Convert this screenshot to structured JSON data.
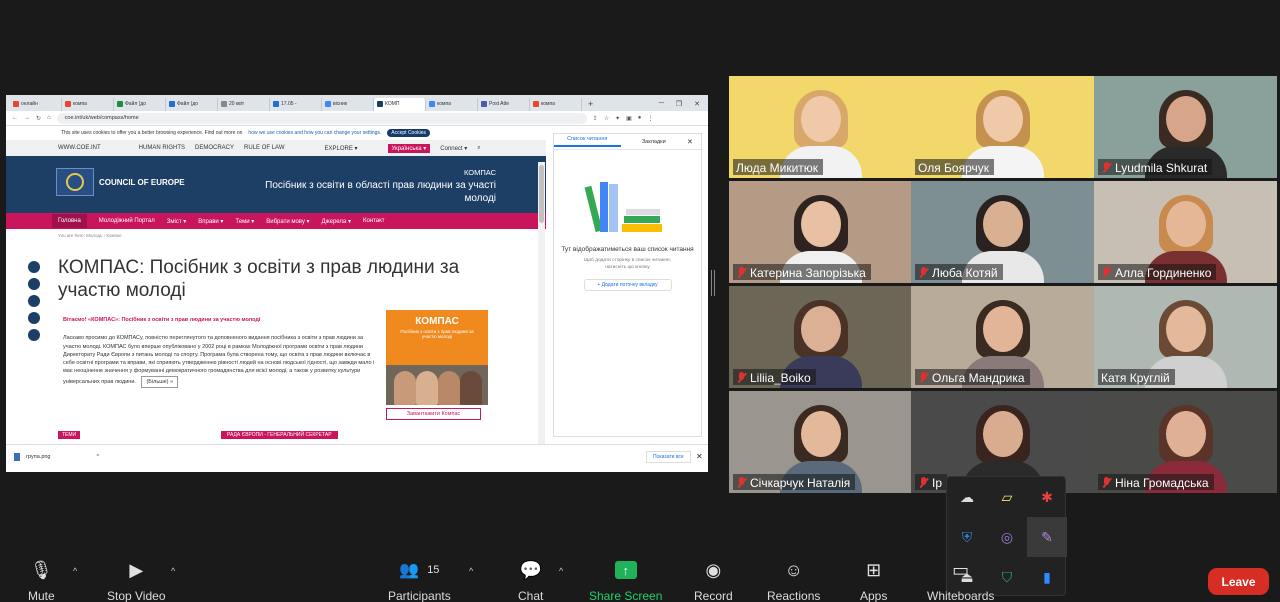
{
  "browser": {
    "tabs": [
      {
        "label": "онлайн",
        "color": "#e8472f"
      },
      {
        "label": "компа",
        "color": "#e8472f"
      },
      {
        "label": "Файл (до",
        "color": "#1e8e3e"
      },
      {
        "label": "Файл (до",
        "color": "#1e6fd9"
      },
      {
        "label": "20 квіт",
        "color": "#888888"
      },
      {
        "label": "17.05 -",
        "color": "#1e6fd9"
      },
      {
        "label": "вісник",
        "color": "#4285f4"
      },
      {
        "label": "КОМП",
        "color": "#1d3f66"
      },
      {
        "label": "компа",
        "color": "#4285f4"
      },
      {
        "label": "Post Atte",
        "color": "#4a5aa8"
      },
      {
        "label": "компа",
        "color": "#e8472f"
      }
    ],
    "url": "coe.int/uk/web/compass/home"
  },
  "site": {
    "cookie_text": "This site uses cookies to offer you a better browsing experience. Find out more on",
    "cookie_link": "how we use cookies and how you can change your settings.",
    "cookie_button": "Accept Cookies",
    "domain": "WWW.COE.INT",
    "topnav": [
      "HUMAN RIGHTS",
      "DEMOCRACY",
      "RULE OF LAW"
    ],
    "explore": "EXPLORE ▾",
    "language": "Українська ▾",
    "connect": "Connect ▾",
    "org_small": "COUNCIL OF EUROPE",
    "org_name": "COUNCIL OF EUROPE",
    "banner_small": "КОМПАС",
    "banner_title": "Посібник з освіти в області прав людини за участі молоді",
    "mainnav": [
      "Головна",
      "Молодіжний Портал",
      "Зміст ▾",
      "Вправи ▾",
      "Теми ▾",
      "Вибрати мову ▾",
      "Джерела ▾",
      "Контакт"
    ],
    "breadcrumb": "You are here:   Молодь   ›   Компас",
    "heading": "КОМПАС: Посібник з освіти з прав людини за участю молоді",
    "lead": "Вітаємо! «КОМПАС»: Посібник з освіти з прав людини за участю молоді",
    "body": "Ласкаво просимо до КОМПАСу, повністю переглянутого та доповненого видання посібника з освіти з прав людини за участю молоді. КОМПАС було вперше опубліковано у 2002 році в рамках Молодіжної програми освіти з прав людини Директорату Ради Європи з питань молоді та спорту. Програма була створена тому, що освіта з прав людини включає в себе освітні програми та вправи, які сприяють утвердженню рівності людей на основі людської гідності, що завжди мало і має неоціненне значення у формуванні демократичного громадянства для всієї молоді, а також у розвитку культури універсальних прав людини.",
    "more": "(Більше) »",
    "book_title": "КОМПАС",
    "book_sub": "Посібник з освіти з прав людини за участю молоді",
    "download": "Завантажити Компас",
    "tag_a": "ТЕМИ",
    "tag_b": "РАДА ЄВРОПИ - ГЕНЕРАЛЬНИЙ СЕКРЕТАР"
  },
  "reading_list": {
    "tab_reading": "Список читання",
    "tab_bookmarks": "Закладки",
    "main": "Тут відображатиметься ваш список читання",
    "sub": "Щоб додати сторінку в список читання, натисніть цю кнопку",
    "button": "+ Додати поточну вкладку"
  },
  "downloads": {
    "file": "група.png",
    "show_all": "Показати все"
  },
  "participants": [
    {
      "name": "Люда Микитюк",
      "muted": false,
      "speaker": true,
      "bg": "#f2d76b",
      "skin": "#f0c9a8",
      "hair": "#d8a86a",
      "shirt": "#f2f2f2"
    },
    {
      "name": "Оля Боярчук",
      "muted": false,
      "speaker": false,
      "bg": "#f2d76b",
      "skin": "#f0c9a8",
      "hair": "#c4924e",
      "shirt": "#f4f4f4"
    },
    {
      "name": "Lyudmila Shkurat",
      "muted": true,
      "speaker": false,
      "bg": "#8aa09a",
      "skin": "#d6a58a",
      "hair": "#3a2a22",
      "shirt": "#2a2a2a"
    },
    {
      "name": "Катерина Запорізька",
      "muted": true,
      "speaker": false,
      "bg": "#b59a86",
      "skin": "#e8c0a4",
      "hair": "#2e2320",
      "shirt": "#f0f0f0"
    },
    {
      "name": "Люба Котяй",
      "muted": true,
      "speaker": false,
      "bg": "#7d8f93",
      "skin": "#d9b092",
      "hair": "#2a2220",
      "shirt": "#e8e8e8"
    },
    {
      "name": "Алла Гординенко",
      "muted": true,
      "speaker": false,
      "bg": "#c8bfb4",
      "skin": "#e6b796",
      "hair": "#c88a4e",
      "shirt": "#7a3030"
    },
    {
      "name": "Liliia_Boiko",
      "muted": true,
      "speaker": false,
      "bg": "#6b6655",
      "skin": "#dcb094",
      "hair": "#4a3226",
      "shirt": "#3a3a5a"
    },
    {
      "name": "Ольга Мандрика",
      "muted": true,
      "speaker": false,
      "bg": "#b8ab9a",
      "skin": "#e2b498",
      "hair": "#3a2a22",
      "shirt": "#8a7a7a"
    },
    {
      "name": "Катя Круглій",
      "muted": false,
      "speaker": false,
      "bg": "#b0b8b4",
      "skin": "#e4b89a",
      "hair": "#6a4a34",
      "shirt": "#d0d0d0"
    },
    {
      "name": "Січкарчук Наталія",
      "muted": true,
      "speaker": false,
      "bg": "#9a958e",
      "skin": "#e4b89a",
      "hair": "#3a2a22",
      "shirt": "#5a6a7a"
    },
    {
      "name": "Ір",
      "muted": true,
      "speaker": false,
      "bg": "#4a4a4a",
      "skin": "#d9ac90",
      "hair": "#3a2420",
      "shirt": "#2a2a2a"
    },
    {
      "name": "Ніна Громадська",
      "muted": true,
      "speaker": false,
      "bg": "#4a4a48",
      "skin": "#e0b096",
      "hair": "#5a3428",
      "shirt": "#8a2a3a"
    }
  ],
  "popup_icons": [
    "cloud-off-icon",
    "note-icon",
    "app-icon",
    "shield-warning-icon",
    "viber-icon",
    "feather-icon",
    "usb-icon",
    "security-icon",
    "zoom-icon"
  ],
  "toolbar": {
    "mute": "Mute",
    "stop_video": "Stop Video",
    "participants": "Participants",
    "participants_count": "15",
    "chat": "Chat",
    "share_screen": "Share Screen",
    "record": "Record",
    "reactions": "Reactions",
    "apps": "Apps",
    "whiteboards": "Whiteboards",
    "leave": "Leave"
  }
}
